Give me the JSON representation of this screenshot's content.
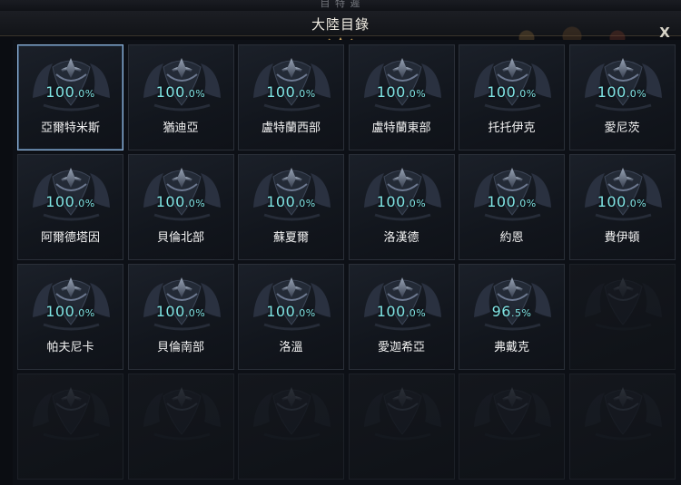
{
  "header": {
    "top_label": "目 特 遲",
    "title": "大陸目錄",
    "close_label": "X"
  },
  "continents": [
    {
      "name": "亞爾特米斯",
      "pct_int": "100",
      "pct_dec": ".0%",
      "selected": true
    },
    {
      "name": "猶迪亞",
      "pct_int": "100",
      "pct_dec": ".0%"
    },
    {
      "name": "盧特蘭西部",
      "pct_int": "100",
      "pct_dec": ".0%"
    },
    {
      "name": "盧特蘭東部",
      "pct_int": "100",
      "pct_dec": ".0%"
    },
    {
      "name": "托托伊克",
      "pct_int": "100",
      "pct_dec": ".0%"
    },
    {
      "name": "愛尼茨",
      "pct_int": "100",
      "pct_dec": ".0%"
    },
    {
      "name": "阿爾德塔因",
      "pct_int": "100",
      "pct_dec": ".0%"
    },
    {
      "name": "貝倫北部",
      "pct_int": "100",
      "pct_dec": ".0%"
    },
    {
      "name": "蘇夏爾",
      "pct_int": "100",
      "pct_dec": ".0%"
    },
    {
      "name": "洛漢德",
      "pct_int": "100",
      "pct_dec": ".0%"
    },
    {
      "name": "約恩",
      "pct_int": "100",
      "pct_dec": ".0%"
    },
    {
      "name": "費伊頓",
      "pct_int": "100",
      "pct_dec": ".0%"
    },
    {
      "name": "帕夫尼卡",
      "pct_int": "100",
      "pct_dec": ".0%"
    },
    {
      "name": "貝倫南部",
      "pct_int": "100",
      "pct_dec": ".0%"
    },
    {
      "name": "洛溫",
      "pct_int": "100",
      "pct_dec": ".0%"
    },
    {
      "name": "愛迦希亞",
      "pct_int": "100",
      "pct_dec": ".0%"
    },
    {
      "name": "弗戴克",
      "pct_int": "96",
      "pct_dec": ".5%"
    }
  ],
  "empty_slots": 7,
  "colors": {
    "percent": "#7fe3e3",
    "selected_border": "#8fb3d9",
    "panel_bg": "#0d1016"
  }
}
